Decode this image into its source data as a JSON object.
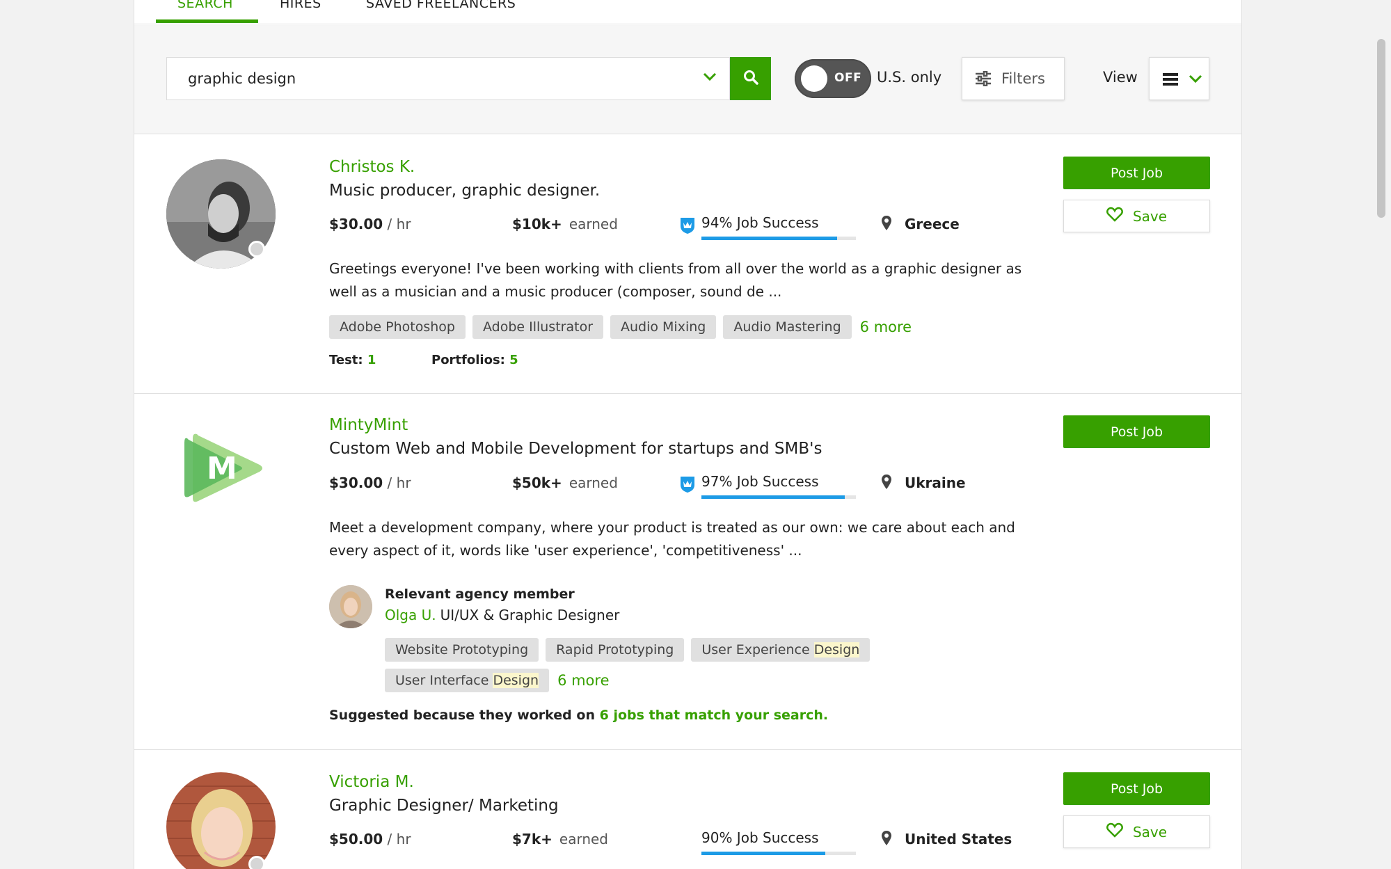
{
  "tabs": [
    {
      "label": "SEARCH",
      "active": true
    },
    {
      "label": "HIRES",
      "active": false
    },
    {
      "label": "SAVED FREELANCERS",
      "active": false
    }
  ],
  "search": {
    "value": "graphic design",
    "toggle_label": "OFF",
    "us_only_label": "U.S. only",
    "filters_label": "Filters",
    "view_label": "View"
  },
  "colors": {
    "accent": "#37a000",
    "jss_blue": "#1d9be6"
  },
  "results": [
    {
      "name": "Christos K.",
      "title": "Music producer, graphic designer.",
      "rate": "$30.00",
      "rate_unit": "/ hr",
      "earned": "$10k+",
      "earned_label": "earned",
      "job_success": "94% Job Success",
      "job_success_pct": 0.88,
      "location": "Greece",
      "description": "Greetings everyone! I've been working with clients from all over the world as a graphic designer as well as a musician and a music producer (composer, sound de ...",
      "skills": [
        "Adobe Photoshop",
        "Adobe Illustrator",
        "Audio Mixing",
        "Audio Mastering"
      ],
      "more": "6 more",
      "test_label": "Test:",
      "test_value": "1",
      "portfolios_label": "Portfolios:",
      "portfolios_value": "5",
      "post_job_label": "Post Job",
      "save_label": "Save"
    },
    {
      "name": "MintyMint",
      "title": "Custom Web and Mobile Development for startups and SMB's",
      "rate": "$30.00",
      "rate_unit": "/ hr",
      "earned": "$50k+",
      "earned_label": "earned",
      "job_success": "97% Job Success",
      "job_success_pct": 0.93,
      "location": "Ukraine",
      "description": "Meet a development company, where your product is treated as our own: we care about each and every aspect of it, words like 'user experience', 'competitiveness' ...",
      "agency_heading": "Relevant agency member",
      "agency_member_name": "Olga U.",
      "agency_member_title": "UI/UX & Graphic Designer",
      "agency_skills": [
        "Website Prototyping",
        "Rapid Prototyping",
        "User Experience ",
        "User Interface "
      ],
      "agency_skill_highlight": "Design",
      "more": "6 more",
      "suggest_prefix": "Suggested because they worked on",
      "suggest_link": "6 jobs that match your search.",
      "post_job_label": "Post Job",
      "logo_letter": "M"
    },
    {
      "name": "Victoria M.",
      "title": "Graphic Designer/ Marketing",
      "rate": "$50.00",
      "rate_unit": "/ hr",
      "earned": "$7k+",
      "earned_label": "earned",
      "job_success": "90% Job Success",
      "job_success_pct": 0.8,
      "location": "United States",
      "post_job_label": "Post Job",
      "save_label": "Save"
    }
  ]
}
